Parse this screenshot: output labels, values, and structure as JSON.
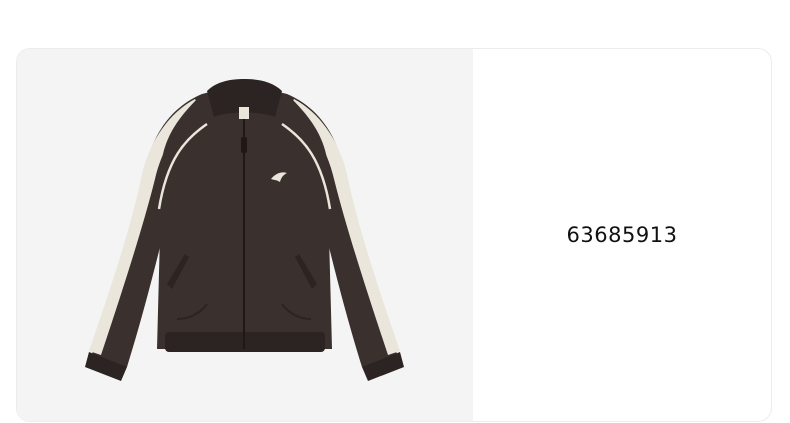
{
  "product": {
    "code": "63685913",
    "image": {
      "subject": "jacket-photo",
      "colors": {
        "body": "#3a302d",
        "body_shade": "#2c2422",
        "stripe": "#eae6dc",
        "logo": "#eae6dc",
        "background": "#f4f4f4"
      }
    }
  }
}
